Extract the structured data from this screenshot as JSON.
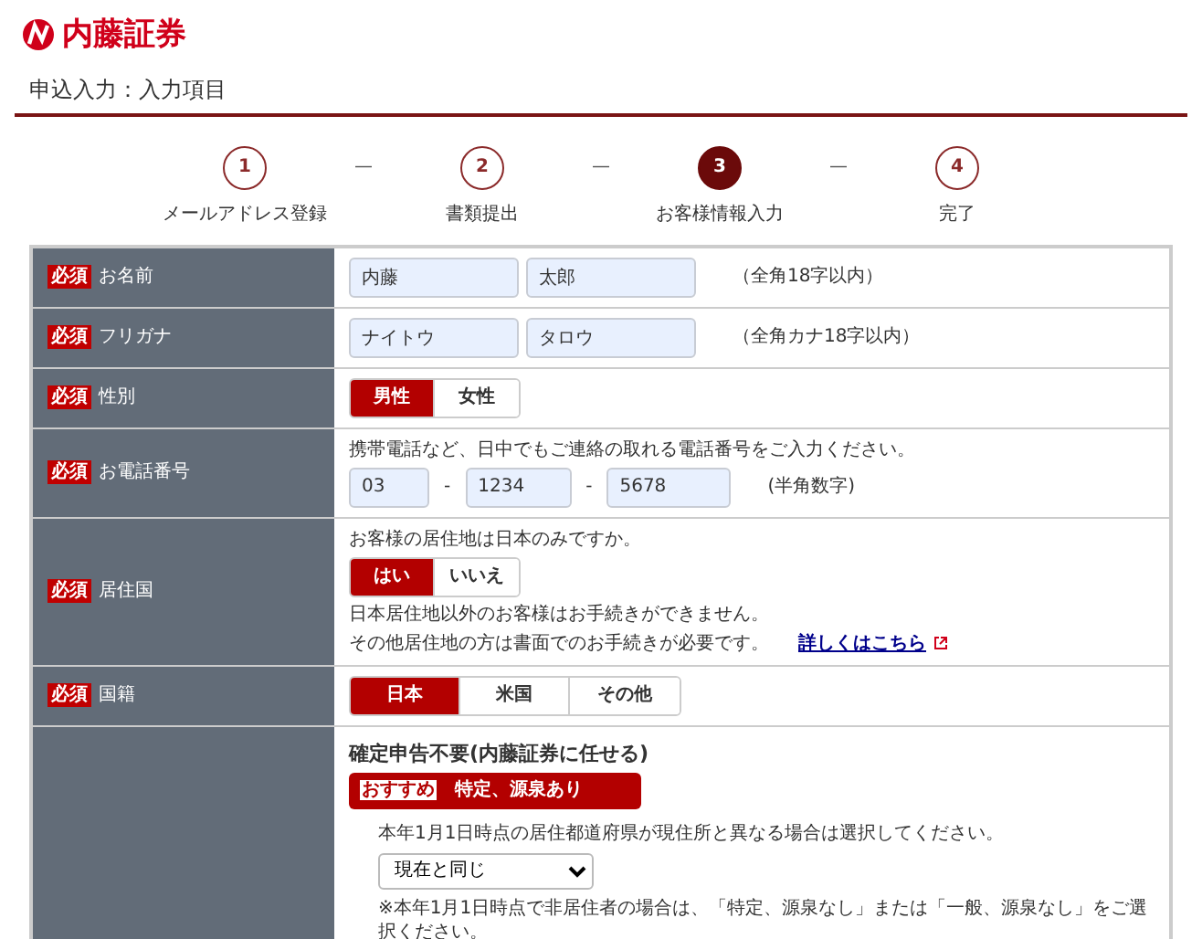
{
  "logo": {
    "text": "内藤証券"
  },
  "page_title": "申込入力：入力項目",
  "steps": [
    {
      "number": "1",
      "label": "メールアドレス登録",
      "selected": false
    },
    {
      "number": "2",
      "label": "書類提出",
      "selected": false
    },
    {
      "number": "3",
      "label": "お客様情報入力",
      "selected": true
    },
    {
      "number": "4",
      "label": "完了",
      "selected": false
    }
  ],
  "step_separator": "—",
  "rows": [
    {
      "kind": "inputs",
      "required_badge": "必須",
      "label": "お名前",
      "fields": [
        {
          "value": "内藤"
        },
        {
          "value": "太郎"
        }
      ],
      "note": "（全角18字以内）"
    },
    {
      "kind": "inputs",
      "required_badge": "必須",
      "label": "フリガナ",
      "fields": [
        {
          "value": "ナイトウ"
        },
        {
          "value": "タロウ"
        }
      ],
      "note": "（全角カナ18字以内）"
    },
    {
      "kind": "toggle",
      "required_badge": "必須",
      "label": "性別",
      "options": [
        {
          "label": "男性",
          "selected": true
        },
        {
          "label": "女性",
          "selected": false
        }
      ]
    },
    {
      "kind": "phone",
      "required_badge": "必須",
      "label": "お電話番号",
      "intro": "携帯電話など、日中でもご連絡の取れる電話番号をご入力ください。",
      "fields": [
        {
          "value": "03"
        },
        {
          "value": "1234"
        },
        {
          "value": "5678"
        }
      ],
      "separators": [
        "-",
        "-"
      ],
      "note": "(半角数字)"
    },
    {
      "kind": "toggle",
      "required_badge": "必須",
      "label": "居住国",
      "intro": "お客様の居住地は日本のみですか。",
      "options": [
        {
          "label": "はい",
          "selected": true
        },
        {
          "label": "いいえ",
          "selected": false
        }
      ],
      "notes": [
        "日本居住地以外のお客様はお手続きができません。",
        "その他居住地の方は書面でのお手続きが必要です。"
      ],
      "link": "詳しくはこちら"
    },
    {
      "kind": "toggle",
      "required_badge": "必須",
      "label": "国籍",
      "options": [
        {
          "label": "日本",
          "selected": true
        },
        {
          "label": "米国",
          "selected": false
        },
        {
          "label": "その他",
          "selected": false
        }
      ]
    },
    {
      "kind": "tax",
      "heading": "確定申告不要(内藤証券に任せる)",
      "button": {
        "badge": "おすすめ",
        "label": "特定、源泉あり"
      },
      "intro": "本年1月1日時点の居住都道府県が現住所と異なる場合は選択してください。",
      "select": "現在と同じ",
      "footnote": "※本年1月1日時点で非居住者の場合は、「特定、源泉なし」または「一般、源泉なし」をご選択ください。"
    }
  ]
}
